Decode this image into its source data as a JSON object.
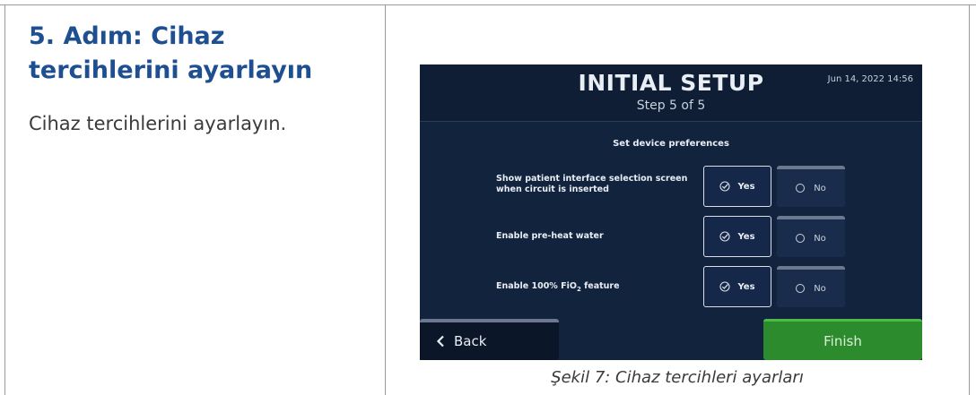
{
  "left": {
    "title": "5. Adım: Cihaz tercihlerini ayarlayın",
    "description": "Cihaz tercihlerini ayarlayın."
  },
  "screen": {
    "title": "INITIAL SETUP",
    "subtitle": "Step 5 of 5",
    "datetime": "Jun 14, 2022 14:56",
    "section_title": "Set device preferences",
    "preferences": [
      {
        "label_line1": "Show patient interface selection screen",
        "label_line2": "when circuit is inserted",
        "yes": "Yes",
        "no": "No",
        "selected": "Yes"
      },
      {
        "label_line1": "Enable pre-heat water",
        "label_line2": "",
        "yes": "Yes",
        "no": "No",
        "selected": "Yes"
      },
      {
        "label_prefix": "Enable 100% FiO",
        "label_sub": "2",
        "label_suffix": " feature",
        "yes": "Yes",
        "no": "No",
        "selected": "Yes"
      }
    ],
    "back_label": "Back",
    "finish_label": "Finish"
  },
  "caption": "Şekil 7: Cihaz tercihleri ayarları",
  "colors": {
    "title_blue": "#1d4f91",
    "screen_bg": "#12233d",
    "finish_green": "#2c8c2d"
  }
}
